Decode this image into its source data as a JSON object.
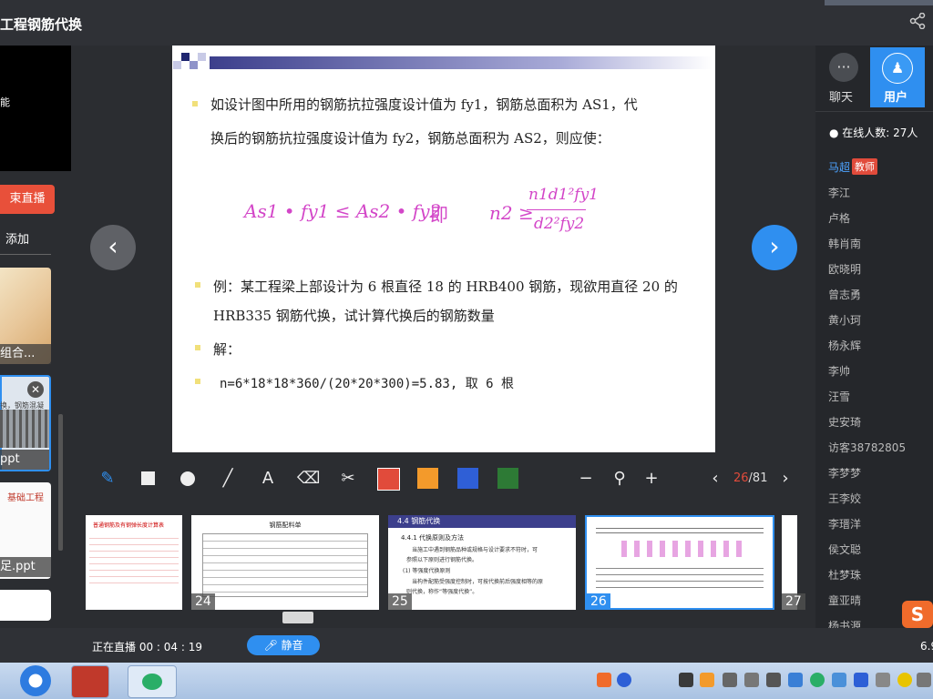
{
  "window": {
    "title": "工程钢筋代换"
  },
  "left_panel": {
    "video_text": "能",
    "end_live_label": "束直播",
    "add_label": "添加",
    "thumbs": [
      {
        "caption": "组合..."
      },
      {
        "caption": "ppt",
        "preview_text": "换，钢筋混凝"
      },
      {
        "caption": "足.ppt",
        "preview_text": "基础工程"
      }
    ]
  },
  "slide": {
    "bullet1_line1": "如设计图中所用的钢筋抗拉强度设计值为 fy1，钢筋总面积为 AS1，代",
    "bullet1_line2": "换后的钢筋抗拉强度设计值为 fy2，钢筋总面积为 AS2，则应使：",
    "formula_left": "As1 • fy1 ≤ As2 • fy2",
    "formula_mid": "即",
    "formula_right": "n2 ≥ n1d1²fy1 / d2²fy2",
    "formula_right_lhs": "n2 ≥",
    "formula_right_num": "n1d1²fy1",
    "formula_right_den": "d2²fy2",
    "bullet2_line1": "例：某工程梁上部设计为 6 根直径 18 的 HRB400 钢筋，现欲用直径 20 的",
    "bullet2_line2": "HRB335 钢筋代换，试计算代换后的钢筋数量",
    "bullet3": "解：",
    "bullet4": "n=6*18*18*360/(20*20*300)=5.83, 取 6 根"
  },
  "toolbar": {
    "page_current": "26",
    "page_total": "/81",
    "colors": [
      "#e14b3b",
      "#f39a2b",
      "#2f5fd6",
      "#2d7a35"
    ]
  },
  "thumbnails": [
    {
      "num": "",
      "title": "普通钢筋及有钢弹长度计算表"
    },
    {
      "num": "24",
      "title": "钢筋配料单"
    },
    {
      "num": "25",
      "title": "4.4 钢筋代换",
      "sub": "4.4.1 代换原则及方法",
      "line1": "当施工中遇到钢筋品种或规格与设计要求不符时，可",
      "line2": "参照以下原则进行钢筋代换。",
      "line3": "(1) 等强度代换原则",
      "line4": "当构件配筋受强度控制时，可按代换前后强度相等的原",
      "line5": "则代换，称作“等强度代换”。"
    },
    {
      "num": "26",
      "title": ""
    },
    {
      "num": "27",
      "title": ""
    }
  ],
  "right_panel": {
    "chat_label": "聊天",
    "user_label": "用户",
    "online_count": "在线人数: 27人",
    "teacher_badge": "教师",
    "users": [
      "马超",
      "李江",
      "卢格",
      "韩肖南",
      "欧晓明",
      "曾志勇",
      "黄小珂",
      "杨永辉",
      "李帅",
      "汪雪",
      "史安琦",
      "访客38782805",
      "李梦梦",
      "王李姣",
      "李瑨洋",
      "侯文聪",
      "杜梦珠",
      "童亚晴",
      "杨书源"
    ]
  },
  "bottom": {
    "live_status": "正在直播 00 : 04 : 19",
    "mute_label": "静音",
    "version": "6.9"
  }
}
